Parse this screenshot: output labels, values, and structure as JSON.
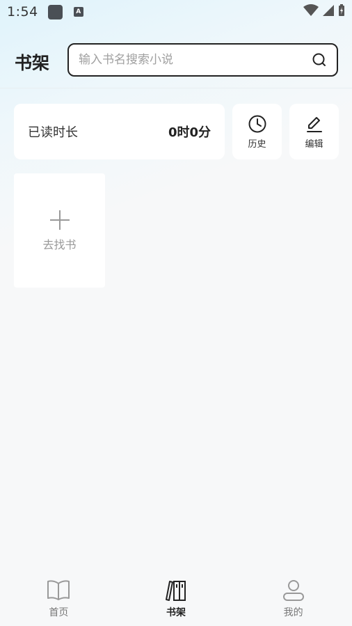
{
  "status_bar": {
    "time": "1:54",
    "a_icon_text": "A"
  },
  "header": {
    "title": "书架"
  },
  "search": {
    "placeholder": "输入书名搜索小说"
  },
  "reading": {
    "label": "已读时长",
    "value": "0时0分"
  },
  "actions": {
    "history_label": "历史",
    "edit_label": "编辑"
  },
  "shelf": {
    "find_book_label": "去找书"
  },
  "nav": {
    "items": [
      {
        "label": "首页",
        "icon": "open-book-icon",
        "active": false
      },
      {
        "label": "书架",
        "icon": "bookshelf-icon",
        "active": true
      },
      {
        "label": "我的",
        "icon": "user-icon",
        "active": false
      }
    ]
  },
  "colors": {
    "active": "#222222",
    "inactive": "#777777",
    "background": "#f7f8f9"
  }
}
